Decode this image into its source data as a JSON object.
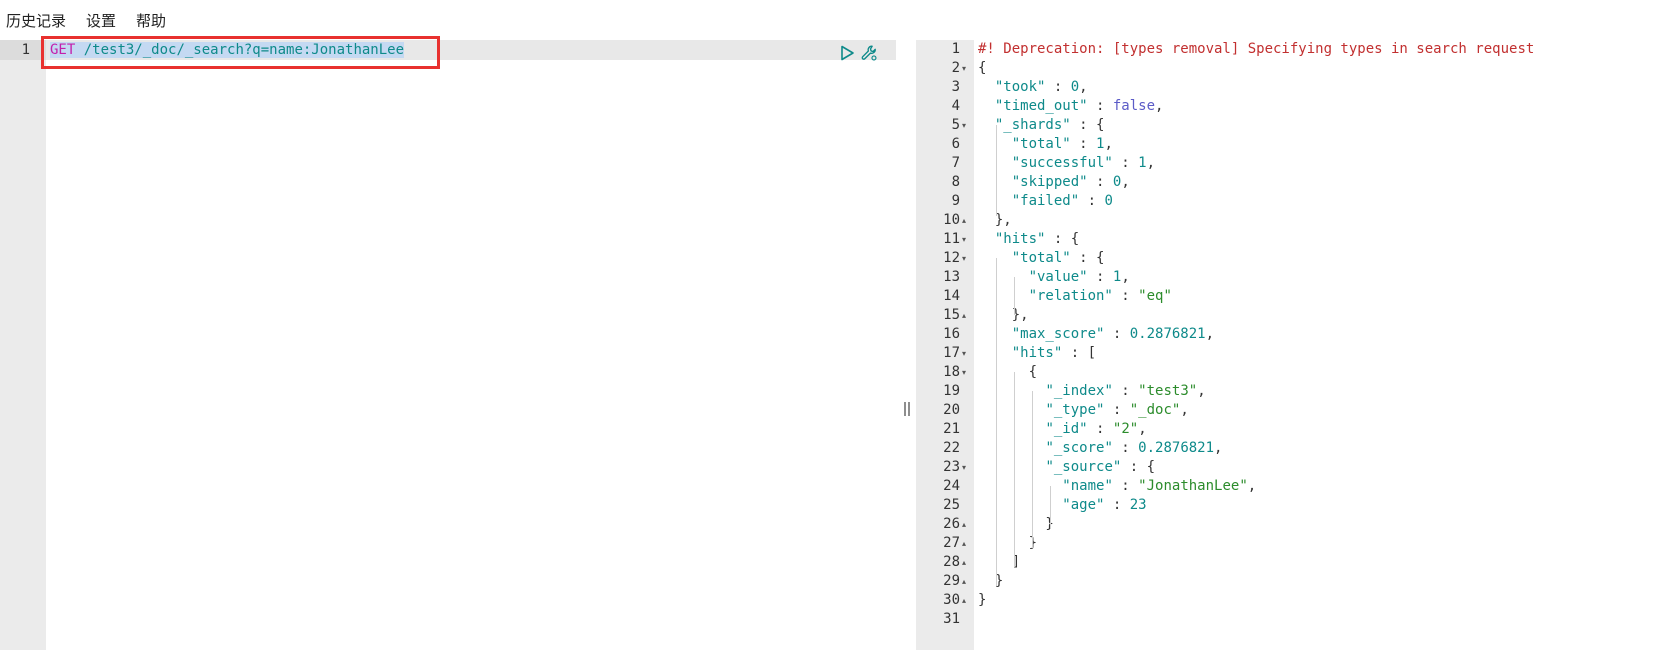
{
  "menu": {
    "history": "历史记录",
    "settings": "设置",
    "help": "帮助"
  },
  "request": {
    "line_number": "1",
    "method": "GET",
    "path": " /test3/_doc/_search?q=name:JonathanLee"
  },
  "toolbar": {
    "run_icon": "play-icon",
    "settings_icon": "wrench-icon"
  },
  "colors": {
    "highlight_box": "#e8312f",
    "method": "#c31fab",
    "key": "#0e8a8a",
    "string": "#2c8c2c",
    "boolean": "#5b5bc7",
    "comment": "#c23030"
  },
  "response": {
    "lines": [
      {
        "n": "1",
        "fold": "",
        "text": "#! Deprecation: [types removal] Specifying types in search request"
      },
      {
        "n": "2",
        "fold": "▾",
        "text": "{"
      },
      {
        "n": "3",
        "fold": "",
        "text": "  \"took\" : 0,"
      },
      {
        "n": "4",
        "fold": "",
        "text": "  \"timed_out\" : false,"
      },
      {
        "n": "5",
        "fold": "▾",
        "text": "  \"_shards\" : {"
      },
      {
        "n": "6",
        "fold": "",
        "text": "    \"total\" : 1,"
      },
      {
        "n": "7",
        "fold": "",
        "text": "    \"successful\" : 1,"
      },
      {
        "n": "8",
        "fold": "",
        "text": "    \"skipped\" : 0,"
      },
      {
        "n": "9",
        "fold": "",
        "text": "    \"failed\" : 0"
      },
      {
        "n": "10",
        "fold": "▴",
        "text": "  },"
      },
      {
        "n": "11",
        "fold": "▾",
        "text": "  \"hits\" : {"
      },
      {
        "n": "12",
        "fold": "▾",
        "text": "    \"total\" : {"
      },
      {
        "n": "13",
        "fold": "",
        "text": "      \"value\" : 1,"
      },
      {
        "n": "14",
        "fold": "",
        "text": "      \"relation\" : \"eq\""
      },
      {
        "n": "15",
        "fold": "▴",
        "text": "    },"
      },
      {
        "n": "16",
        "fold": "",
        "text": "    \"max_score\" : 0.2876821,"
      },
      {
        "n": "17",
        "fold": "▾",
        "text": "    \"hits\" : ["
      },
      {
        "n": "18",
        "fold": "▾",
        "text": "      {"
      },
      {
        "n": "19",
        "fold": "",
        "text": "        \"_index\" : \"test3\","
      },
      {
        "n": "20",
        "fold": "",
        "text": "        \"_type\" : \"_doc\","
      },
      {
        "n": "21",
        "fold": "",
        "text": "        \"_id\" : \"2\","
      },
      {
        "n": "22",
        "fold": "",
        "text": "        \"_score\" : 0.2876821,"
      },
      {
        "n": "23",
        "fold": "▾",
        "text": "        \"_source\" : {"
      },
      {
        "n": "24",
        "fold": "",
        "text": "          \"name\" : \"JonathanLee\","
      },
      {
        "n": "25",
        "fold": "",
        "text": "          \"age\" : 23"
      },
      {
        "n": "26",
        "fold": "▴",
        "text": "        }"
      },
      {
        "n": "27",
        "fold": "▴",
        "text": "      }"
      },
      {
        "n": "28",
        "fold": "▴",
        "text": "    ]"
      },
      {
        "n": "29",
        "fold": "▴",
        "text": "  }"
      },
      {
        "n": "30",
        "fold": "▴",
        "text": "}"
      },
      {
        "n": "31",
        "fold": "",
        "text": ""
      }
    ]
  }
}
